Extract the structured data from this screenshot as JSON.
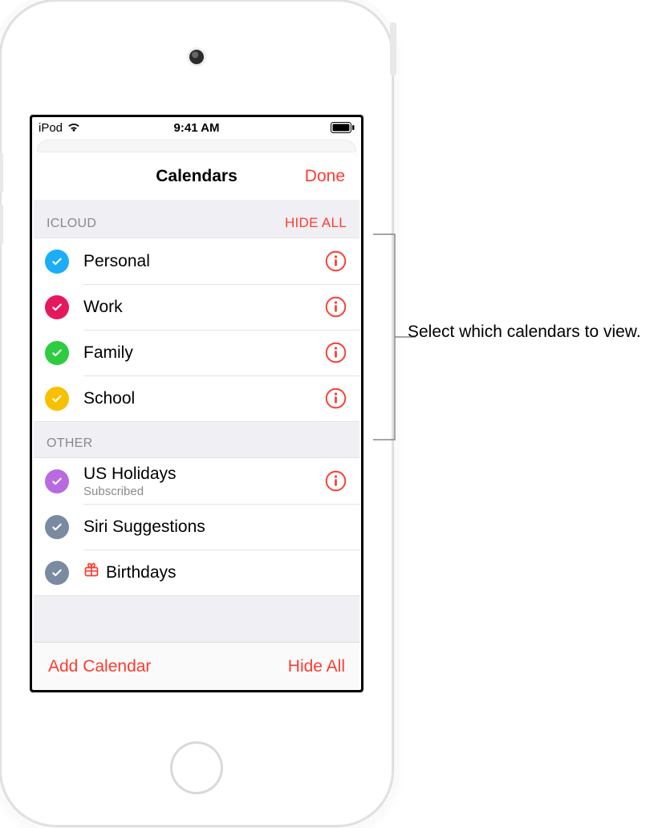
{
  "status": {
    "device": "iPod",
    "time": "9:41 AM"
  },
  "nav": {
    "title": "Calendars",
    "done": "Done"
  },
  "sections": [
    {
      "key": "icloud",
      "header": "ICLOUD",
      "headerAction": "HIDE ALL",
      "rows": [
        {
          "label": "Personal",
          "color": "#1badf8",
          "checked": true,
          "info": true
        },
        {
          "label": "Work",
          "color": "#e6185d",
          "checked": true,
          "info": true
        },
        {
          "label": "Family",
          "color": "#2ecc40",
          "checked": true,
          "info": true
        },
        {
          "label": "School",
          "color": "#f7c000",
          "checked": true,
          "info": true
        }
      ]
    },
    {
      "key": "other",
      "header": "OTHER",
      "rows": [
        {
          "label": "US Holidays",
          "sub": "Subscribed",
          "color": "#b96ae0",
          "checked": true,
          "info": true
        },
        {
          "label": "Siri Suggestions",
          "color": "#7a8aa1",
          "checked": true,
          "info": false
        },
        {
          "label": "Birthdays",
          "icon": "gift",
          "iconColor": "#ff3b30",
          "color": "#7a8aa1",
          "checked": true,
          "info": false
        }
      ]
    }
  ],
  "toolbar": {
    "add": "Add Calendar",
    "hideAll": "Hide All"
  },
  "callout": {
    "text": "Select which calendars to view."
  },
  "accent": "#ff3b30"
}
